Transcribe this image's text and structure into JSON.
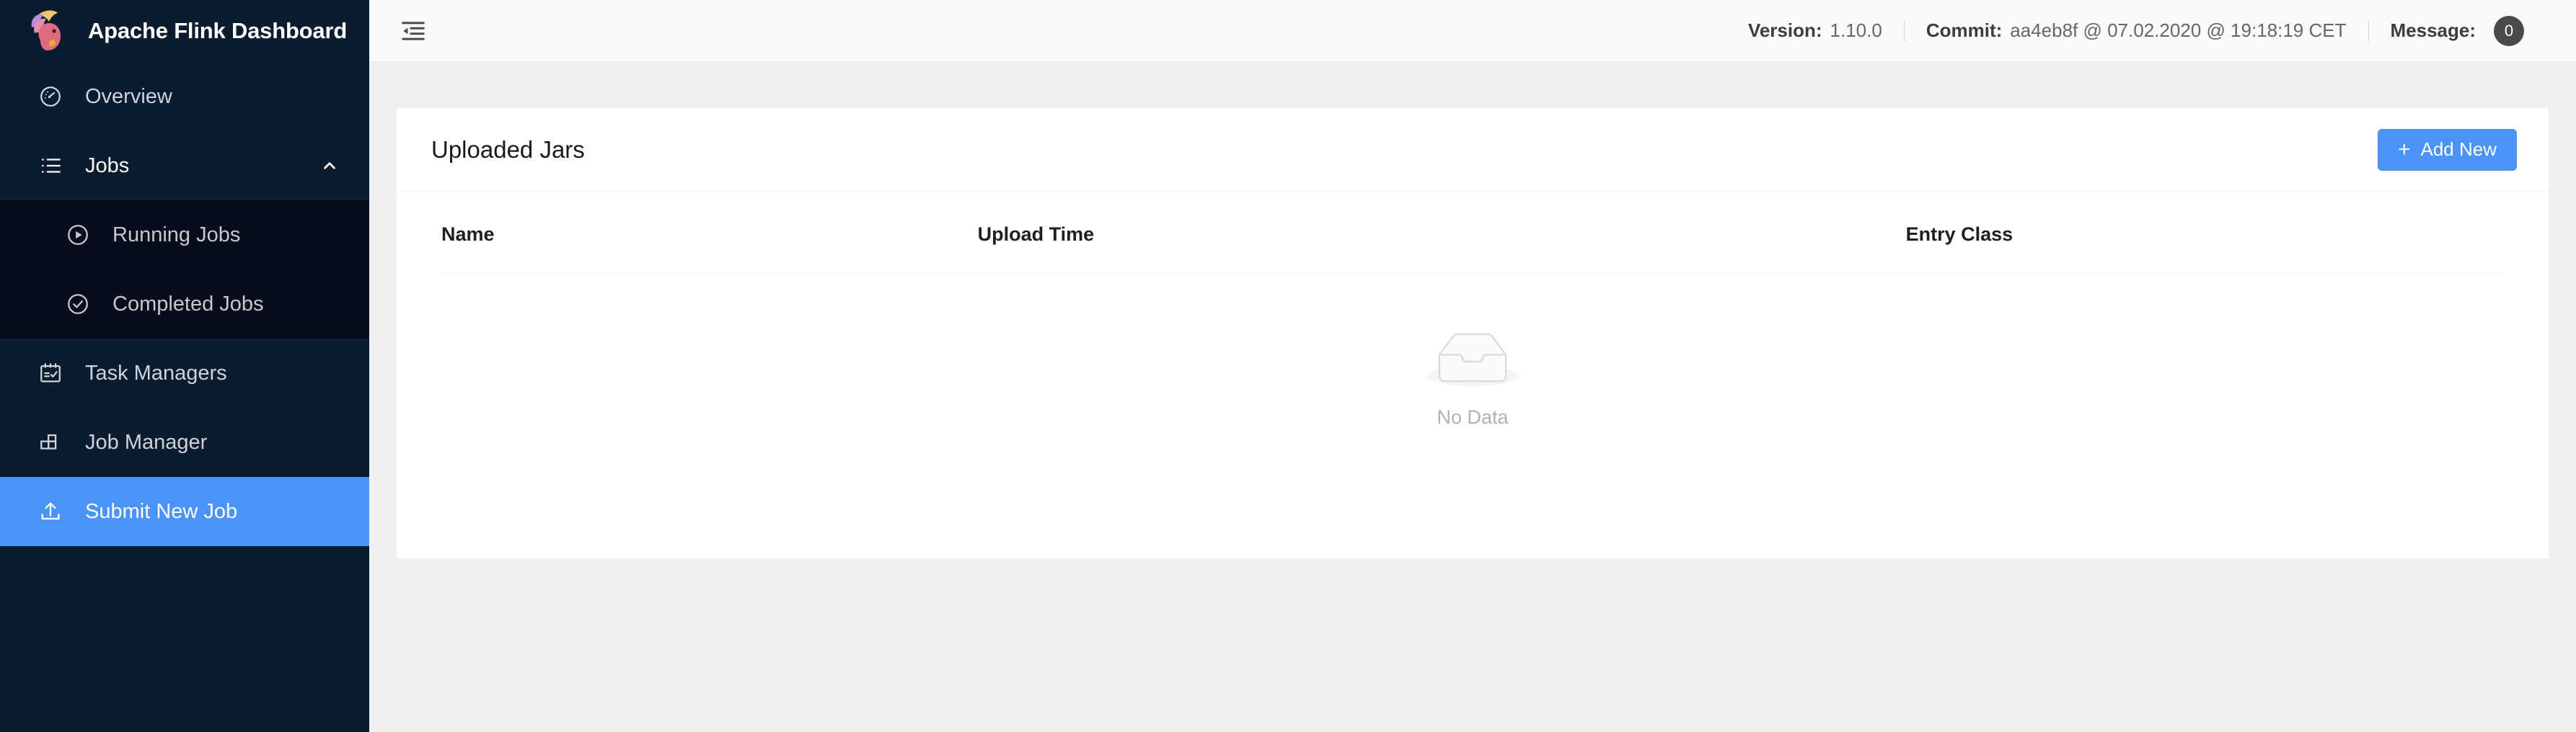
{
  "brand": {
    "title": "Apache Flink Dashboard",
    "logo_icon": "flink-squirrel-logo"
  },
  "sidebar": {
    "items": [
      {
        "label": "Overview",
        "icon": "dashboard-gauge-icon",
        "selected": false
      },
      {
        "label": "Jobs",
        "icon": "ordered-list-icon",
        "selected": false,
        "expanded": true,
        "arrow_icon": "chevron-up-icon"
      },
      {
        "label": "Running Jobs",
        "icon": "play-circle-icon",
        "selected": false,
        "child": true
      },
      {
        "label": "Completed Jobs",
        "icon": "check-circle-icon",
        "selected": false,
        "child": true
      },
      {
        "label": "Task Managers",
        "icon": "schedule-calendar-icon",
        "selected": false
      },
      {
        "label": "Job Manager",
        "icon": "blocks-cluster-icon",
        "selected": false
      },
      {
        "label": "Submit New Job",
        "icon": "upload-icon",
        "selected": true
      }
    ],
    "selected_color": "#4b93f7",
    "background": "#0b1c2e",
    "submenu_background": "#050e1a"
  },
  "topbar": {
    "fold_icon": "menu-fold-icon",
    "version_label": "Version:",
    "version_value": "1.10.0",
    "commit_label": "Commit:",
    "commit_value": "aa4eb8f @ 07.02.2020 @ 19:18:19 CET",
    "message_label": "Message:",
    "message_count": "0"
  },
  "main": {
    "card_title": "Uploaded Jars",
    "add_button": {
      "label": "Add New",
      "plus_icon": "plus-icon",
      "color": "#4b93f7"
    },
    "table": {
      "columns": [
        "Name",
        "Upload Time",
        "Entry Class"
      ],
      "rows": [],
      "empty_icon": "empty-inbox-icon",
      "empty_text": "No Data"
    }
  }
}
